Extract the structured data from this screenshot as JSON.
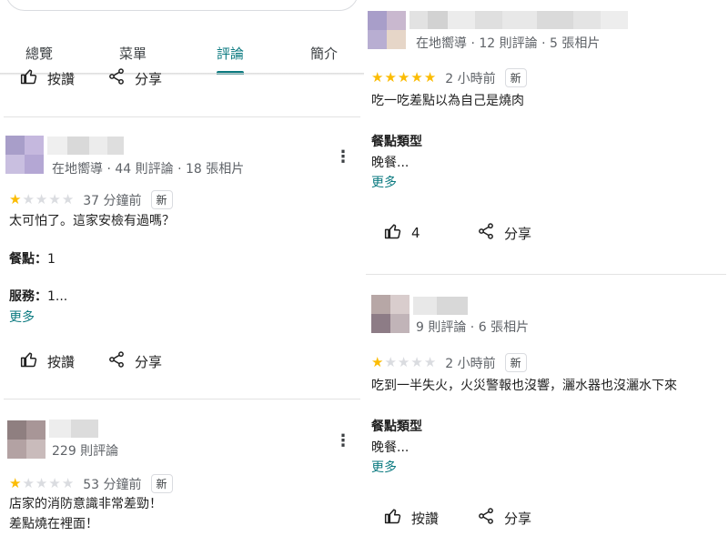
{
  "tabs": [
    {
      "label": "總覽"
    },
    {
      "label": "菜單"
    },
    {
      "label": "評論",
      "active": true
    },
    {
      "label": "簡介"
    }
  ],
  "actions": {
    "like_label": "按讚",
    "share_label": "分享"
  },
  "reviews_left": [
    {
      "meta": "在地嚮導 · 44 則評論 · 18 張相片",
      "rating": 1,
      "time": "37 分鐘前",
      "badge": "新",
      "text": "太可怕了。這家安檢有過嗎？",
      "fields": [
        {
          "label": "餐點：",
          "value": "1"
        },
        {
          "label": "服務：",
          "value": "1..."
        }
      ],
      "more": "更多"
    },
    {
      "meta": "229 則評論",
      "rating": 1,
      "time": "53 分鐘前",
      "badge": "新",
      "text_lines": [
        "店家的消防意識非常差勁！",
        "差點燒在裡面！"
      ]
    }
  ],
  "reviews_right": [
    {
      "meta": "在地嚮導 · 12 則評論 · 5 張相片",
      "rating": 5,
      "time": "2 小時前",
      "badge": "新",
      "text": "吃一吃差點以為自己是燒肉",
      "section_title": "餐點類型",
      "section_value": "晚餐...",
      "more": "更多",
      "likes": "4",
      "share_label": "分享"
    },
    {
      "meta": "9 則評論 · 6 張相片",
      "rating": 1,
      "time": "2 小時前",
      "badge": "新",
      "text": "吃到一半失火，火災警報也沒響，灑水器也沒灑水下來",
      "section_title": "餐點類型",
      "section_value": "晚餐...",
      "more": "更多",
      "like_label": "按讚",
      "share_label": "分享"
    }
  ],
  "colors": {
    "accent": "#0b7a80",
    "star_on": "#fbbc04",
    "star_off": "#dadce0"
  },
  "icons": [
    "thumbs-up-icon",
    "share-icon",
    "more-vert-icon",
    "star-icon"
  ]
}
